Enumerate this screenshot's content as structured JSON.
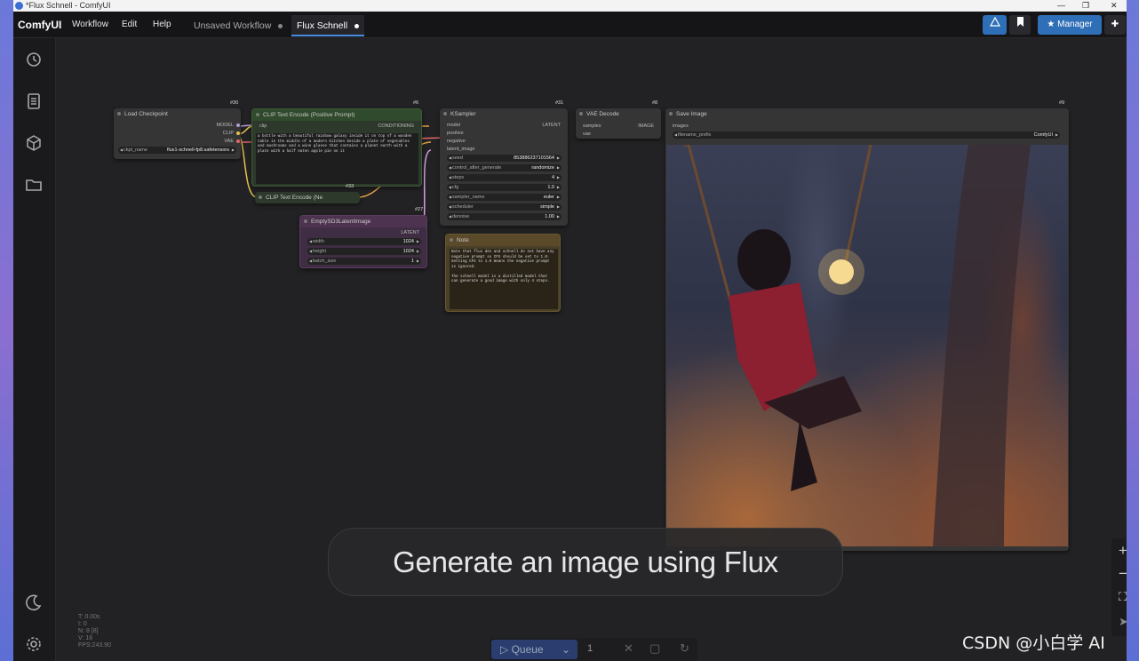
{
  "window": {
    "title": "*Flux Schnell - ComfyUI"
  },
  "menubar": {
    "brand": "ComfyUI",
    "menus": [
      "Workflow",
      "Edit",
      "Help"
    ],
    "tabs": [
      {
        "label": "Unsaved Workflow"
      },
      {
        "label": "Flux Schnell"
      }
    ],
    "manager_label": "Manager"
  },
  "nodes": {
    "load_checkpoint": {
      "title": "Load Checkpoint",
      "id": "#30",
      "outputs": [
        "MODEL",
        "CLIP",
        "VAE"
      ],
      "ckpt_label": "ckpt_name",
      "ckpt_value": "flux1-schnell-fp8.safetensors"
    },
    "clip_pos": {
      "title": "CLIP Text Encode (Positive Prompt)",
      "id": "#6",
      "input": "clip",
      "output": "CONDITIONING",
      "text": "a bottle with a beautiful rainbow galaxy inside it on top of a wooden table in the middle of a modern kitchen beside a plate of vegetables and mushrooms and a wine glasse that contains a planet earth with a plate with a half eaten apple pie on it"
    },
    "clip_neg": {
      "title": "CLIP Text Encode (Ne",
      "id": "#33"
    },
    "empty_latent": {
      "title": "EmptySD3LatentImage",
      "id": "#27",
      "output": "LATENT",
      "widgets": [
        {
          "label": "width",
          "value": "1024"
        },
        {
          "label": "height",
          "value": "1024"
        },
        {
          "label": "batch_size",
          "value": "1"
        }
      ]
    },
    "ksampler": {
      "title": "KSampler",
      "id": "#31",
      "inputs": [
        "model",
        "positive",
        "negative",
        "latent_image"
      ],
      "output": "LATENT",
      "widgets": [
        {
          "label": "seed",
          "value": "853886237101564"
        },
        {
          "label": "control_after_generate",
          "value": "randomize"
        },
        {
          "label": "steps",
          "value": "4"
        },
        {
          "label": "cfg",
          "value": "1.0"
        },
        {
          "label": "sampler_name",
          "value": "euler"
        },
        {
          "label": "scheduler",
          "value": "simple"
        },
        {
          "label": "denoise",
          "value": "1.00"
        }
      ]
    },
    "vae_decode": {
      "title": "VAE Decode",
      "id": "#8",
      "inputs": [
        "samples",
        "vae"
      ],
      "output": "IMAGE"
    },
    "save_image": {
      "title": "Save Image",
      "id": "#9",
      "input": "images",
      "prefix_label": "filename_prefix",
      "prefix_value": "ComfyUI"
    },
    "note": {
      "title": "Note",
      "text": "Note that flux dev and schnell do not have any negative prompt so CFG should be set to 1.0. Setting CFG to 1.0 means the negative prompt is ignored.\n\nThe schnell model is a distilled model that can generate a good image with only 4 steps."
    }
  },
  "caption": "Generate an image using Flux",
  "stats": [
    "T: 0.00s",
    "I: 0",
    "N: 8 [8]",
    "V: 16",
    "FPS:243.90"
  ],
  "queue": {
    "label": "Queue",
    "count": "1"
  },
  "watermark": "CSDN @小白学 AI",
  "colors": {
    "accent": "#4a8be0",
    "clip_node": "#2f4a2c",
    "latent_node": "#4d3350",
    "note_node": "#5a4a2a",
    "canvas": "#222224"
  }
}
